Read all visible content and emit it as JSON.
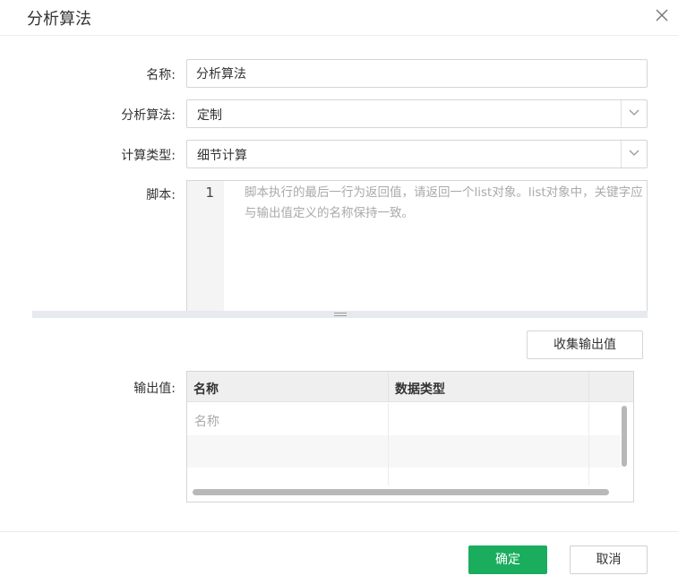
{
  "dialog": {
    "title": "分析算法"
  },
  "form": {
    "name_label": "名称:",
    "name_value": "分析算法",
    "algorithm_label": "分析算法:",
    "algorithm_value": "定制",
    "calc_type_label": "计算类型:",
    "calc_type_value": "细节计算",
    "script_label": "脚本:",
    "script_line_number": "1",
    "script_placeholder": "脚本执行的最后一行为返回值，请返回一个list对象。list对象中，关键字应与输出值定义的名称保持一致。",
    "collect_button": "收集输出值",
    "output_label": "输出值:"
  },
  "output_table": {
    "columns": [
      "名称",
      "数据类型"
    ],
    "name_placeholder": "名称"
  },
  "footer": {
    "ok_label": "确定",
    "cancel_label": "取消"
  },
  "colors": {
    "primary": "#1aad5e"
  }
}
